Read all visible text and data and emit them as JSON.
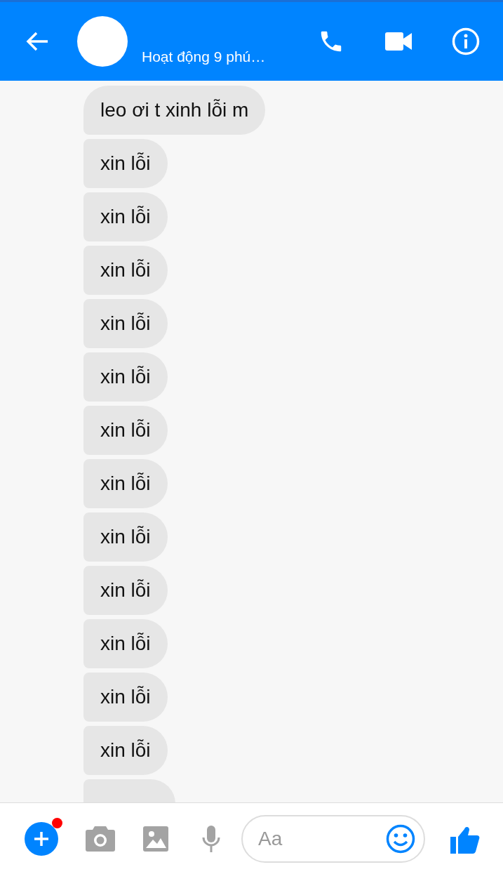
{
  "header": {
    "status": "Hoạt động 9 phú…"
  },
  "messages": [
    {
      "text": "leo ơi t xinh lỗi m"
    },
    {
      "text": "xin lỗi"
    },
    {
      "text": "xin lỗi"
    },
    {
      "text": "xin lỗi"
    },
    {
      "text": "xin lỗi"
    },
    {
      "text": "xin lỗi"
    },
    {
      "text": "xin lỗi"
    },
    {
      "text": "xin lỗi"
    },
    {
      "text": "xin lỗi"
    },
    {
      "text": "xin lỗi"
    },
    {
      "text": "xin lỗi"
    },
    {
      "text": "xin lỗi"
    },
    {
      "text": "xin lỗi"
    }
  ],
  "cut_off_message": true,
  "composer": {
    "placeholder": "Aa",
    "plus_badge": true
  }
}
